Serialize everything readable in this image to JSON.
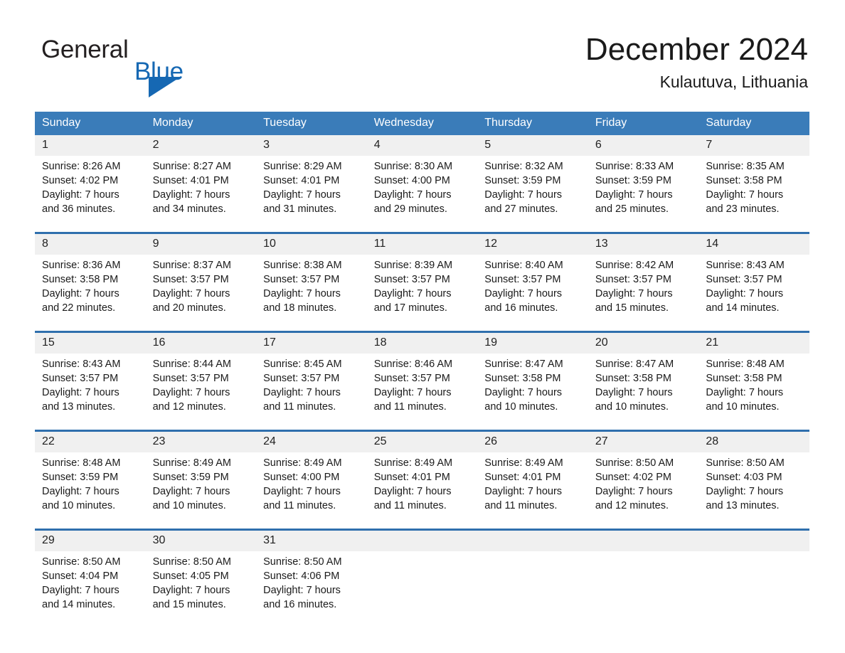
{
  "brand": {
    "name_part1": "General",
    "name_part2": "Blue",
    "accent_color": "#1668b3",
    "triangle_icon": "triangle-icon"
  },
  "header": {
    "title": "December 2024",
    "subtitle": "Kulautuva, Lithuania"
  },
  "calendar": {
    "header_bg": "#3a7cb9",
    "row_divider_color": "#2f6fad",
    "daynum_bg": "#f0f0f0",
    "weekdays": [
      "Sunday",
      "Monday",
      "Tuesday",
      "Wednesday",
      "Thursday",
      "Friday",
      "Saturday"
    ],
    "weeks": [
      [
        {
          "day": "1",
          "sunrise": "Sunrise: 8:26 AM",
          "sunset": "Sunset: 4:02 PM",
          "daylight1": "Daylight: 7 hours",
          "daylight2": "and 36 minutes."
        },
        {
          "day": "2",
          "sunrise": "Sunrise: 8:27 AM",
          "sunset": "Sunset: 4:01 PM",
          "daylight1": "Daylight: 7 hours",
          "daylight2": "and 34 minutes."
        },
        {
          "day": "3",
          "sunrise": "Sunrise: 8:29 AM",
          "sunset": "Sunset: 4:01 PM",
          "daylight1": "Daylight: 7 hours",
          "daylight2": "and 31 minutes."
        },
        {
          "day": "4",
          "sunrise": "Sunrise: 8:30 AM",
          "sunset": "Sunset: 4:00 PM",
          "daylight1": "Daylight: 7 hours",
          "daylight2": "and 29 minutes."
        },
        {
          "day": "5",
          "sunrise": "Sunrise: 8:32 AM",
          "sunset": "Sunset: 3:59 PM",
          "daylight1": "Daylight: 7 hours",
          "daylight2": "and 27 minutes."
        },
        {
          "day": "6",
          "sunrise": "Sunrise: 8:33 AM",
          "sunset": "Sunset: 3:59 PM",
          "daylight1": "Daylight: 7 hours",
          "daylight2": "and 25 minutes."
        },
        {
          "day": "7",
          "sunrise": "Sunrise: 8:35 AM",
          "sunset": "Sunset: 3:58 PM",
          "daylight1": "Daylight: 7 hours",
          "daylight2": "and 23 minutes."
        }
      ],
      [
        {
          "day": "8",
          "sunrise": "Sunrise: 8:36 AM",
          "sunset": "Sunset: 3:58 PM",
          "daylight1": "Daylight: 7 hours",
          "daylight2": "and 22 minutes."
        },
        {
          "day": "9",
          "sunrise": "Sunrise: 8:37 AM",
          "sunset": "Sunset: 3:57 PM",
          "daylight1": "Daylight: 7 hours",
          "daylight2": "and 20 minutes."
        },
        {
          "day": "10",
          "sunrise": "Sunrise: 8:38 AM",
          "sunset": "Sunset: 3:57 PM",
          "daylight1": "Daylight: 7 hours",
          "daylight2": "and 18 minutes."
        },
        {
          "day": "11",
          "sunrise": "Sunrise: 8:39 AM",
          "sunset": "Sunset: 3:57 PM",
          "daylight1": "Daylight: 7 hours",
          "daylight2": "and 17 minutes."
        },
        {
          "day": "12",
          "sunrise": "Sunrise: 8:40 AM",
          "sunset": "Sunset: 3:57 PM",
          "daylight1": "Daylight: 7 hours",
          "daylight2": "and 16 minutes."
        },
        {
          "day": "13",
          "sunrise": "Sunrise: 8:42 AM",
          "sunset": "Sunset: 3:57 PM",
          "daylight1": "Daylight: 7 hours",
          "daylight2": "and 15 minutes."
        },
        {
          "day": "14",
          "sunrise": "Sunrise: 8:43 AM",
          "sunset": "Sunset: 3:57 PM",
          "daylight1": "Daylight: 7 hours",
          "daylight2": "and 14 minutes."
        }
      ],
      [
        {
          "day": "15",
          "sunrise": "Sunrise: 8:43 AM",
          "sunset": "Sunset: 3:57 PM",
          "daylight1": "Daylight: 7 hours",
          "daylight2": "and 13 minutes."
        },
        {
          "day": "16",
          "sunrise": "Sunrise: 8:44 AM",
          "sunset": "Sunset: 3:57 PM",
          "daylight1": "Daylight: 7 hours",
          "daylight2": "and 12 minutes."
        },
        {
          "day": "17",
          "sunrise": "Sunrise: 8:45 AM",
          "sunset": "Sunset: 3:57 PM",
          "daylight1": "Daylight: 7 hours",
          "daylight2": "and 11 minutes."
        },
        {
          "day": "18",
          "sunrise": "Sunrise: 8:46 AM",
          "sunset": "Sunset: 3:57 PM",
          "daylight1": "Daylight: 7 hours",
          "daylight2": "and 11 minutes."
        },
        {
          "day": "19",
          "sunrise": "Sunrise: 8:47 AM",
          "sunset": "Sunset: 3:58 PM",
          "daylight1": "Daylight: 7 hours",
          "daylight2": "and 10 minutes."
        },
        {
          "day": "20",
          "sunrise": "Sunrise: 8:47 AM",
          "sunset": "Sunset: 3:58 PM",
          "daylight1": "Daylight: 7 hours",
          "daylight2": "and 10 minutes."
        },
        {
          "day": "21",
          "sunrise": "Sunrise: 8:48 AM",
          "sunset": "Sunset: 3:58 PM",
          "daylight1": "Daylight: 7 hours",
          "daylight2": "and 10 minutes."
        }
      ],
      [
        {
          "day": "22",
          "sunrise": "Sunrise: 8:48 AM",
          "sunset": "Sunset: 3:59 PM",
          "daylight1": "Daylight: 7 hours",
          "daylight2": "and 10 minutes."
        },
        {
          "day": "23",
          "sunrise": "Sunrise: 8:49 AM",
          "sunset": "Sunset: 3:59 PM",
          "daylight1": "Daylight: 7 hours",
          "daylight2": "and 10 minutes."
        },
        {
          "day": "24",
          "sunrise": "Sunrise: 8:49 AM",
          "sunset": "Sunset: 4:00 PM",
          "daylight1": "Daylight: 7 hours",
          "daylight2": "and 11 minutes."
        },
        {
          "day": "25",
          "sunrise": "Sunrise: 8:49 AM",
          "sunset": "Sunset: 4:01 PM",
          "daylight1": "Daylight: 7 hours",
          "daylight2": "and 11 minutes."
        },
        {
          "day": "26",
          "sunrise": "Sunrise: 8:49 AM",
          "sunset": "Sunset: 4:01 PM",
          "daylight1": "Daylight: 7 hours",
          "daylight2": "and 11 minutes."
        },
        {
          "day": "27",
          "sunrise": "Sunrise: 8:50 AM",
          "sunset": "Sunset: 4:02 PM",
          "daylight1": "Daylight: 7 hours",
          "daylight2": "and 12 minutes."
        },
        {
          "day": "28",
          "sunrise": "Sunrise: 8:50 AM",
          "sunset": "Sunset: 4:03 PM",
          "daylight1": "Daylight: 7 hours",
          "daylight2": "and 13 minutes."
        }
      ],
      [
        {
          "day": "29",
          "sunrise": "Sunrise: 8:50 AM",
          "sunset": "Sunset: 4:04 PM",
          "daylight1": "Daylight: 7 hours",
          "daylight2": "and 14 minutes."
        },
        {
          "day": "30",
          "sunrise": "Sunrise: 8:50 AM",
          "sunset": "Sunset: 4:05 PM",
          "daylight1": "Daylight: 7 hours",
          "daylight2": "and 15 minutes."
        },
        {
          "day": "31",
          "sunrise": "Sunrise: 8:50 AM",
          "sunset": "Sunset: 4:06 PM",
          "daylight1": "Daylight: 7 hours",
          "daylight2": "and 16 minutes."
        },
        {
          "day": "",
          "sunrise": "",
          "sunset": "",
          "daylight1": "",
          "daylight2": ""
        },
        {
          "day": "",
          "sunrise": "",
          "sunset": "",
          "daylight1": "",
          "daylight2": ""
        },
        {
          "day": "",
          "sunrise": "",
          "sunset": "",
          "daylight1": "",
          "daylight2": ""
        },
        {
          "day": "",
          "sunrise": "",
          "sunset": "",
          "daylight1": "",
          "daylight2": ""
        }
      ]
    ]
  }
}
